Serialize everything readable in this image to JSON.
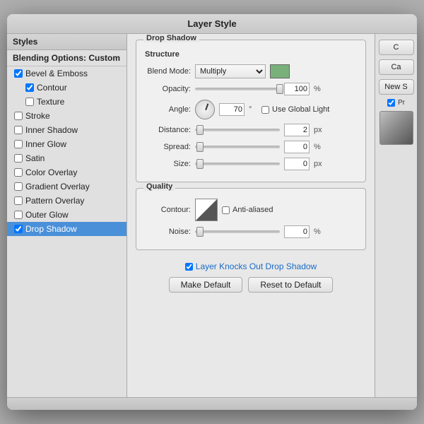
{
  "dialog": {
    "title": "Layer Style"
  },
  "left_panel": {
    "styles_header": "Styles",
    "blending_options": "Blending Options: Custom",
    "items": [
      {
        "id": "bevel-emboss",
        "label": "Bevel & Emboss",
        "checked": true,
        "indent": 0
      },
      {
        "id": "contour",
        "label": "Contour",
        "checked": true,
        "indent": 1
      },
      {
        "id": "texture",
        "label": "Texture",
        "checked": false,
        "indent": 1
      },
      {
        "id": "stroke",
        "label": "Stroke",
        "checked": false,
        "indent": 0
      },
      {
        "id": "inner-shadow",
        "label": "Inner Shadow",
        "checked": false,
        "indent": 0
      },
      {
        "id": "inner-glow",
        "label": "Inner Glow",
        "checked": false,
        "indent": 0
      },
      {
        "id": "satin",
        "label": "Satin",
        "checked": false,
        "indent": 0
      },
      {
        "id": "color-overlay",
        "label": "Color Overlay",
        "checked": false,
        "indent": 0
      },
      {
        "id": "gradient-overlay",
        "label": "Gradient Overlay",
        "checked": false,
        "indent": 0
      },
      {
        "id": "pattern-overlay",
        "label": "Pattern Overlay",
        "checked": false,
        "indent": 0
      },
      {
        "id": "outer-glow",
        "label": "Outer Glow",
        "checked": false,
        "indent": 0
      },
      {
        "id": "drop-shadow",
        "label": "Drop Shadow",
        "checked": true,
        "indent": 0,
        "active": true
      }
    ]
  },
  "main_section": {
    "title": "Drop Shadow",
    "structure": {
      "subtitle": "Structure",
      "blend_mode_label": "Blend Mode:",
      "blend_mode_value": "Multiply",
      "color": "#7ab07a",
      "opacity_label": "Opacity:",
      "opacity_value": "100",
      "opacity_unit": "%",
      "angle_label": "Angle:",
      "angle_value": "70",
      "angle_unit": "°",
      "use_global_light_label": "Use Global Light",
      "use_global_light_checked": false,
      "distance_label": "Distance:",
      "distance_value": "2",
      "distance_unit": "px",
      "spread_label": "Spread:",
      "spread_value": "0",
      "spread_unit": "%",
      "size_label": "Size:",
      "size_value": "0",
      "size_unit": "px"
    },
    "quality": {
      "subtitle": "Quality",
      "contour_label": "Contour:",
      "anti_alias_label": "Anti-aliased",
      "anti_alias_checked": false,
      "noise_label": "Noise:",
      "noise_value": "0",
      "noise_unit": "%"
    },
    "layer_knocks_out": "Layer Knocks Out Drop Shadow",
    "layer_knocks_checked": true,
    "make_default_btn": "Make Default",
    "reset_to_default_btn": "Reset to Default"
  },
  "right_panel": {
    "ok_label": "C",
    "cancel_label": "Ca",
    "new_label": "New S",
    "preview_label": "Pr"
  }
}
